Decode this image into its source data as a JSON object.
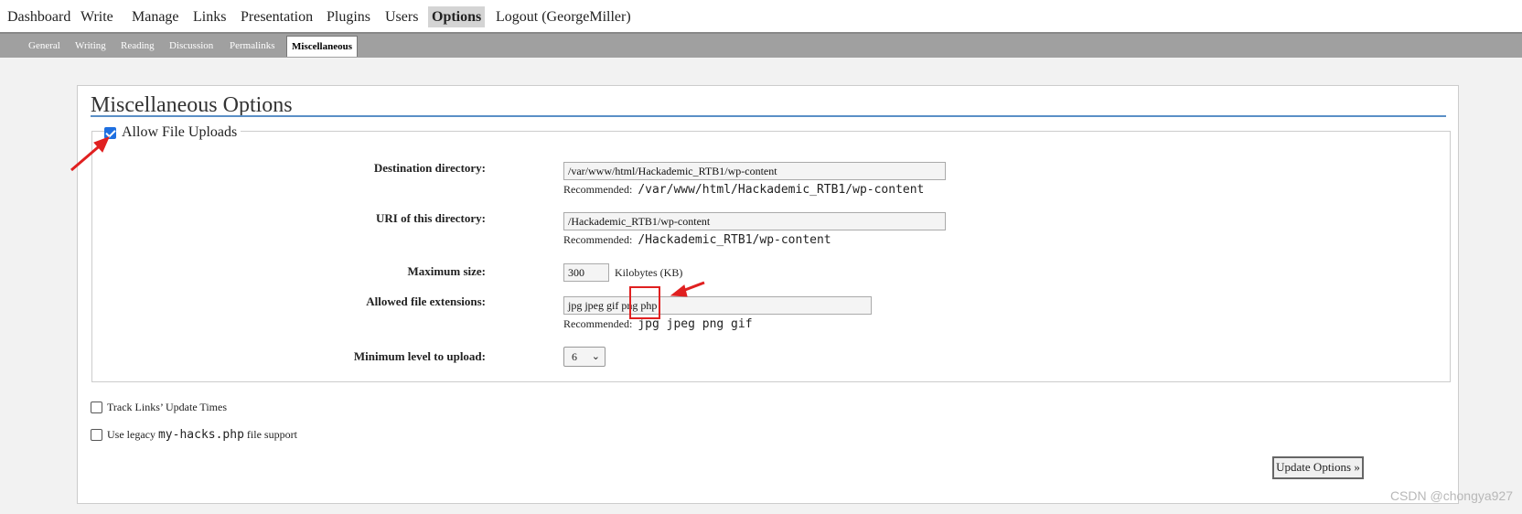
{
  "topnav": {
    "items": [
      "Dashboard",
      "Write",
      "Manage",
      "Links",
      "Presentation",
      "Plugins",
      "Users",
      "Options",
      "Logout (GeorgeMiller)"
    ],
    "active": "Options"
  },
  "subnav": {
    "items": [
      "General",
      "Writing",
      "Reading",
      "Discussion",
      "Permalinks",
      "Miscellaneous"
    ],
    "active": "Miscellaneous"
  },
  "page": {
    "title": "Miscellaneous Options"
  },
  "uploads": {
    "allow_label": "Allow File Uploads",
    "allow_checked": true,
    "dest_dir_label": "Destination directory:",
    "dest_dir_value": "/var/www/html/Hackademic_RTB1/wp-content",
    "dest_dir_rec_prefix": "Recommended:",
    "dest_dir_rec": "/var/www/html/Hackademic_RTB1/wp-content",
    "uri_label": "URI of this directory:",
    "uri_value": "/Hackademic_RTB1/wp-content",
    "uri_rec_prefix": "Recommended:",
    "uri_rec": "/Hackademic_RTB1/wp-content",
    "max_size_label": "Maximum size:",
    "max_size_value": "300",
    "max_size_unit": "Kilobytes (KB)",
    "ext_label": "Allowed file extensions:",
    "ext_value": "jpg jpeg gif png php",
    "ext_rec_prefix": "Recommended:",
    "ext_rec": "jpg jpeg png gif",
    "min_level_label": "Minimum level to upload:",
    "min_level_value": "6"
  },
  "options": {
    "track_links_label": "Track Links’ Update Times",
    "track_links_checked": false,
    "legacy_prefix": "Use legacy",
    "legacy_code": "my-hacks.php",
    "legacy_suffix": "file support",
    "legacy_checked": false
  },
  "update_button": "Update Options »",
  "watermark": "CSDN @chongya927",
  "colors": {
    "annotation": "#e02020",
    "title_rule": "#5a8fc6",
    "checkbox_checked": "#1e6fe0"
  }
}
